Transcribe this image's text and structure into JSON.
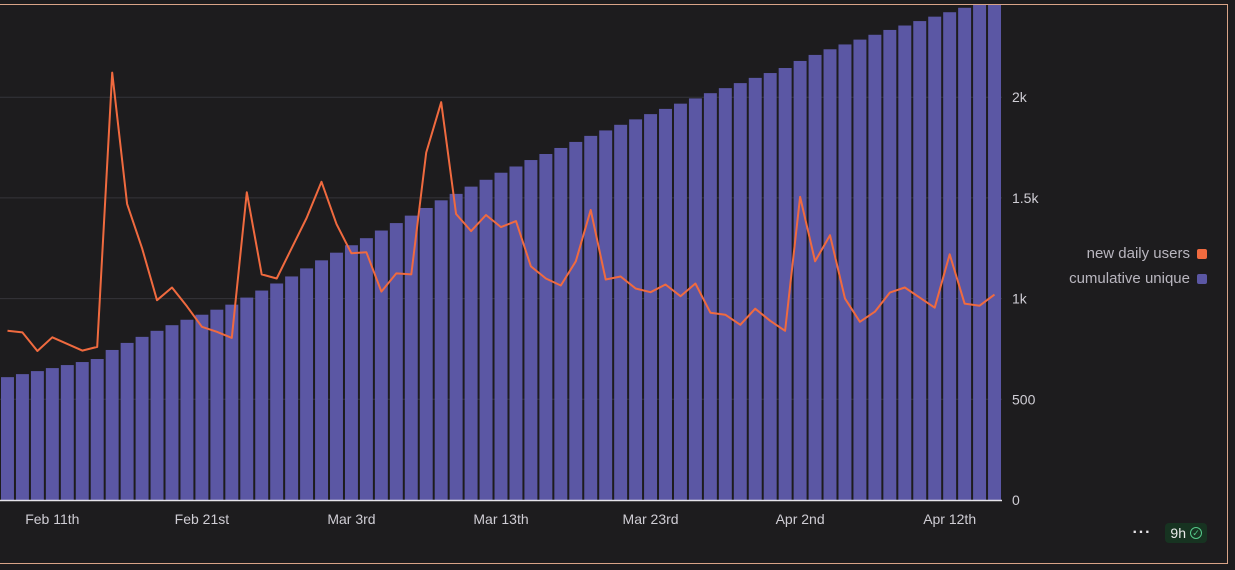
{
  "chart_data": {
    "type": "bar",
    "x_tick_labels": [
      "Feb 11th",
      "Feb 21st",
      "Mar 3rd",
      "Mar 13th",
      "Mar 23rd",
      "Apr 2nd",
      "Apr 12th"
    ],
    "y_tick_labels": [
      "0",
      "500",
      "1k",
      "1.5k",
      "2k"
    ],
    "ylim": [
      0,
      2150
    ],
    "grid": true,
    "legend_position": "right",
    "series": [
      {
        "name": "new daily users",
        "type": "line",
        "color": "#f06a3f",
        "values": [
          840,
          832,
          740,
          808,
          775,
          742,
          760,
          2122,
          1470,
          1250,
          992,
          1055,
          962,
          860,
          835,
          805,
          1528,
          1120,
          1100,
          1250,
          1400,
          1580,
          1370,
          1225,
          1230,
          1035,
          1125,
          1120,
          1725,
          1975,
          1420,
          1335,
          1415,
          1355,
          1385,
          1160,
          1100,
          1065,
          1185,
          1440,
          1095,
          1110,
          1050,
          1032,
          1070,
          1012,
          1075,
          930,
          920,
          870,
          950,
          890,
          840,
          1505,
          1185,
          1315,
          1000,
          885,
          935,
          1030,
          1055,
          1005,
          955,
          1220,
          975,
          965,
          1020
        ]
      },
      {
        "name": "cumulative unique",
        "type": "bar",
        "color": "#5b57a4",
        "values": [
          610,
          625,
          640,
          655,
          670,
          685,
          700,
          745,
          780,
          810,
          840,
          868,
          895,
          920,
          945,
          970,
          1005,
          1040,
          1075,
          1110,
          1150,
          1190,
          1228,
          1265,
          1300,
          1338,
          1375,
          1412,
          1450,
          1488,
          1520,
          1556,
          1590,
          1625,
          1656,
          1688,
          1718,
          1748,
          1778,
          1808,
          1835,
          1863,
          1890,
          1916,
          1942,
          1968,
          1994,
          2020,
          2045,
          2070,
          2096,
          2120,
          2145,
          2180,
          2210,
          2238,
          2262,
          2286,
          2310,
          2334,
          2356,
          2378,
          2400,
          2422,
          2444,
          2462,
          2480
        ]
      }
    ]
  },
  "footer": {
    "more_label": "···",
    "age_label": "9h"
  }
}
